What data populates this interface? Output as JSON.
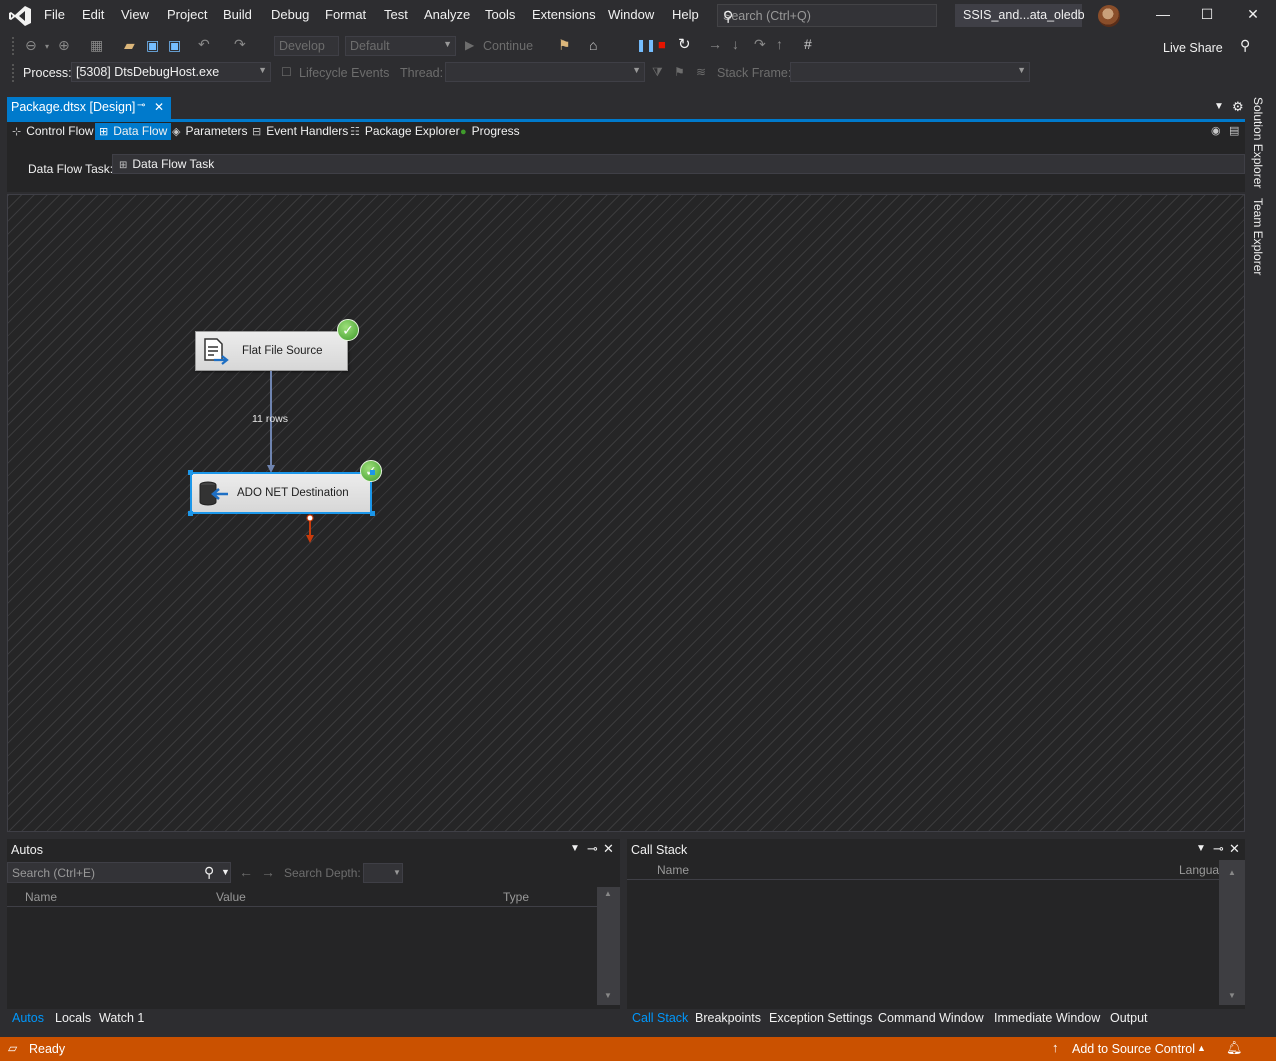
{
  "menu": {
    "items": [
      "File",
      "Edit",
      "View",
      "Project",
      "Build",
      "Debug",
      "Format",
      "Test",
      "Analyze",
      "Tools",
      "Extensions",
      "Window",
      "Help"
    ],
    "search_placeholder": "Search (Ctrl+Q)",
    "solution_name": "SSIS_and...ata_oledb"
  },
  "toolbar": {
    "config_combo": "Develop",
    "platform_combo": "Default",
    "continue_label": "Continue",
    "live_share_label": "Live Share",
    "process_label": "Process:",
    "process_value": "[5308] DtsDebugHost.exe",
    "lifecycle_label": "Lifecycle Events",
    "thread_label": "Thread:",
    "stack_frame_label": "Stack Frame:"
  },
  "document": {
    "tab_title": "Package.dtsx [Design]",
    "designer_tabs": [
      "Control Flow",
      "Data Flow",
      "Parameters",
      "Event Handlers",
      "Package Explorer",
      "Progress"
    ],
    "active_tab": "Data Flow",
    "task_label": "Data Flow Task:",
    "task_value": "Data Flow Task"
  },
  "canvas": {
    "components": [
      {
        "name": "Flat File Source",
        "status": "success"
      },
      {
        "name": "ADO NET Destination",
        "status": "success"
      }
    ],
    "path_label": "11 rows"
  },
  "autos_panel": {
    "title": "Autos",
    "search_placeholder": "Search (Ctrl+E)",
    "search_depth_label": "Search Depth:",
    "columns": [
      "Name",
      "Value",
      "Type"
    ],
    "tabs": [
      "Autos",
      "Locals",
      "Watch 1"
    ],
    "active_tab": "Autos"
  },
  "callstack_panel": {
    "title": "Call Stack",
    "columns": [
      "Name",
      "Langua"
    ],
    "tabs": [
      "Call Stack",
      "Breakpoints",
      "Exception Settings",
      "Command Window",
      "Immediate Window",
      "Output"
    ],
    "active_tab": "Call Stack"
  },
  "side_tabs": [
    "Solution Explorer",
    "Team Explorer"
  ],
  "status": {
    "text": "Ready",
    "source_control": "Add to Source Control"
  },
  "colors": {
    "accent": "#007acc",
    "status_bar": "#ca5100",
    "success": "#3f9b2b",
    "background": "#2d2d30"
  }
}
